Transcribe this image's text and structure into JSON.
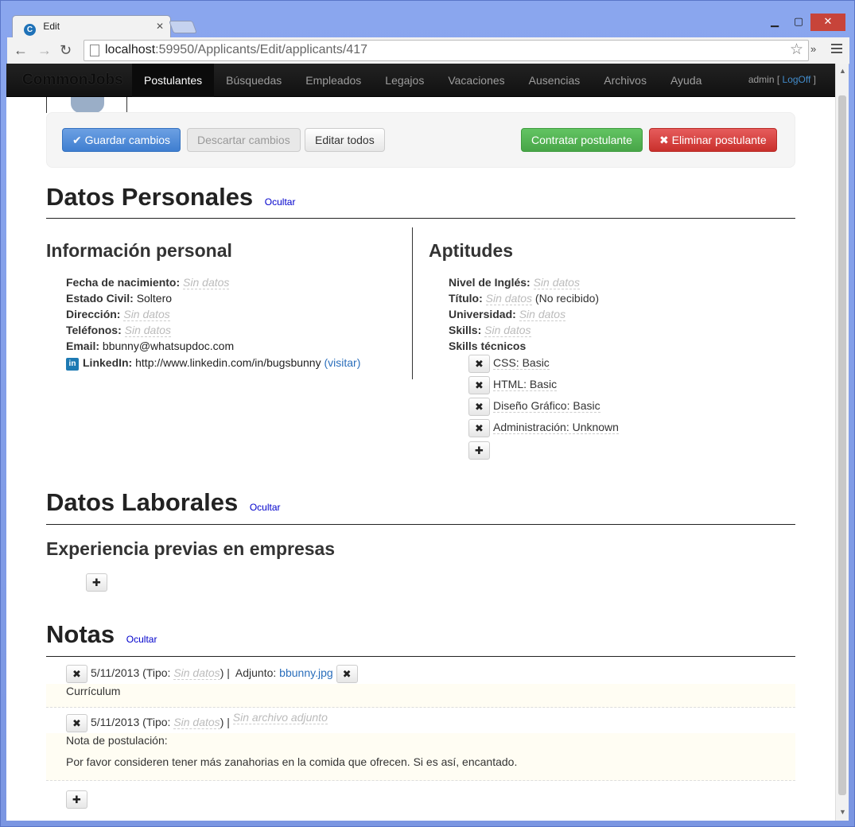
{
  "browser": {
    "tab_title": "Edit",
    "favicon_letter": "C",
    "url_host": "localhost",
    "url_path": ":59950/Applicants/Edit/applicants/417",
    "extensions_glyph": "»"
  },
  "navbar": {
    "brand": "CommonJobs",
    "items": [
      "Postulantes",
      "Búsquedas",
      "Empleados",
      "Legajos",
      "Vacaciones",
      "Ausencias",
      "Archivos",
      "Ayuda"
    ],
    "user": "admin",
    "logoff": "LogOff"
  },
  "actions": {
    "save": "Guardar cambios",
    "discard": "Descartar cambios",
    "edit_all": "Editar todos",
    "hire": "Contratar postulante",
    "delete": "Eliminar postulante"
  },
  "personal": {
    "title": "Datos Personales",
    "toggle": "Ocultar",
    "info_title": "Información personal",
    "birth_label": "Fecha de nacimiento:",
    "birth_value": "Sin datos",
    "civil_label": "Estado Civil:",
    "civil_value": "Soltero",
    "address_label": "Dirección:",
    "address_value": "Sin datos",
    "phones_label": "Teléfonos:",
    "phones_value": "Sin datos",
    "email_label": "Email:",
    "email_value": "bbunny@whatsupdoc.com",
    "linkedin_label": "LinkedIn:",
    "linkedin_value": "http://www.linkedin.com/in/bugsbunny",
    "linkedin_visit": "(visitar)",
    "skills_title": "Aptitudes",
    "english_label": "Nivel de Inglés:",
    "english_value": "Sin datos",
    "degree_label": "Título:",
    "degree_value": "Sin datos",
    "degree_status": "(No recibido)",
    "university_label": "Universidad:",
    "university_value": "Sin datos",
    "skills_label": "Skills:",
    "skills_value": "Sin datos",
    "tech_label": "Skills técnicos",
    "tech_skills": [
      "CSS: Basic",
      "HTML: Basic",
      "Diseño Gráfico: Basic",
      "Administración: Unknown"
    ]
  },
  "work": {
    "title": "Datos Laborales",
    "toggle": "Ocultar",
    "experience_title": "Experiencia previas en empresas"
  },
  "notes": {
    "title": "Notas",
    "toggle": "Ocultar",
    "items": [
      {
        "date": "5/11/2013",
        "type_prefix": "(Tipo:",
        "type_value": "Sin datos",
        "type_suffix": ") |",
        "attachment_label": "Adjunto:",
        "attachment": "bbunny.jpg",
        "body": "Currículum"
      },
      {
        "date": "5/11/2013",
        "type_prefix": "(Tipo:",
        "type_value": "Sin datos",
        "type_suffix": ") |",
        "no_attachment": "Sin archivo adjunto",
        "body_title": "Nota de postulación:",
        "body": "Por favor consideren tener más zanahorias en la comida que ofrecen. Si es así, encantado."
      }
    ]
  }
}
